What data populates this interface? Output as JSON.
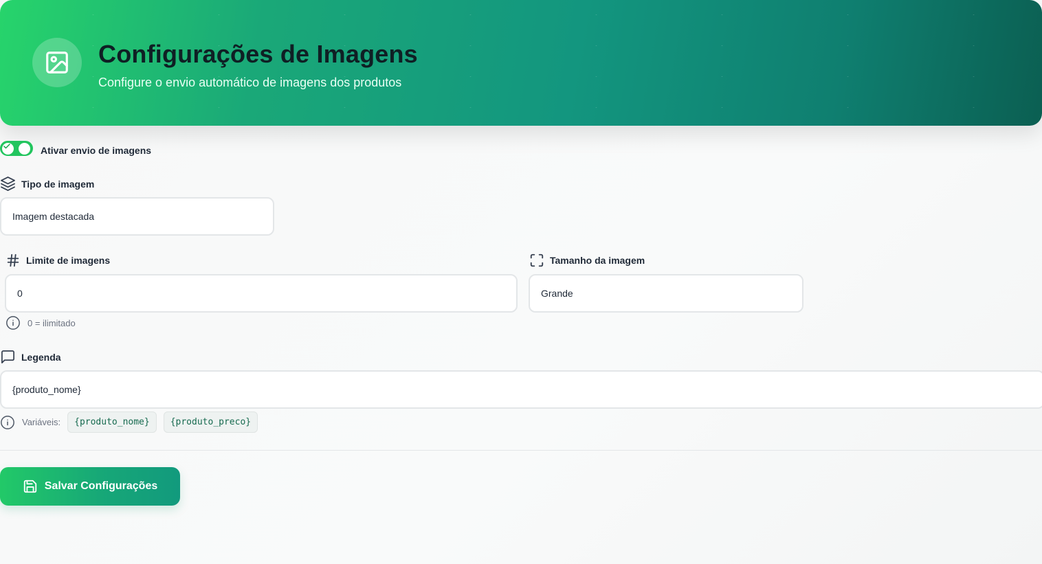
{
  "header": {
    "title": "Configurações de Imagens",
    "subtitle": "Configure o envio automático de imagens dos produtos",
    "icon": "image-icon"
  },
  "toggle": {
    "label": "Ativar envio de imagens",
    "enabled": true
  },
  "image_type": {
    "label": "Tipo de imagem",
    "value": "Imagem destacada",
    "icon": "layers-icon"
  },
  "image_limit": {
    "label": "Limite de imagens",
    "value": "0",
    "hint": "0 = ilimitado",
    "icon": "hash-icon"
  },
  "image_size": {
    "label": "Tamanho da imagem",
    "value": "Grande",
    "icon": "maximize-icon"
  },
  "caption": {
    "label": "Legenda",
    "value": "{produto_nome}",
    "icon": "message-square-icon",
    "variables_label": "Variáveis:",
    "variables": [
      "{produto_nome}",
      "{produto_preco}"
    ]
  },
  "save_button": {
    "label": "Salvar Configurações",
    "icon": "save-icon"
  },
  "colors": {
    "accent": "#22c55e",
    "header_dark": "#0b5f52"
  }
}
